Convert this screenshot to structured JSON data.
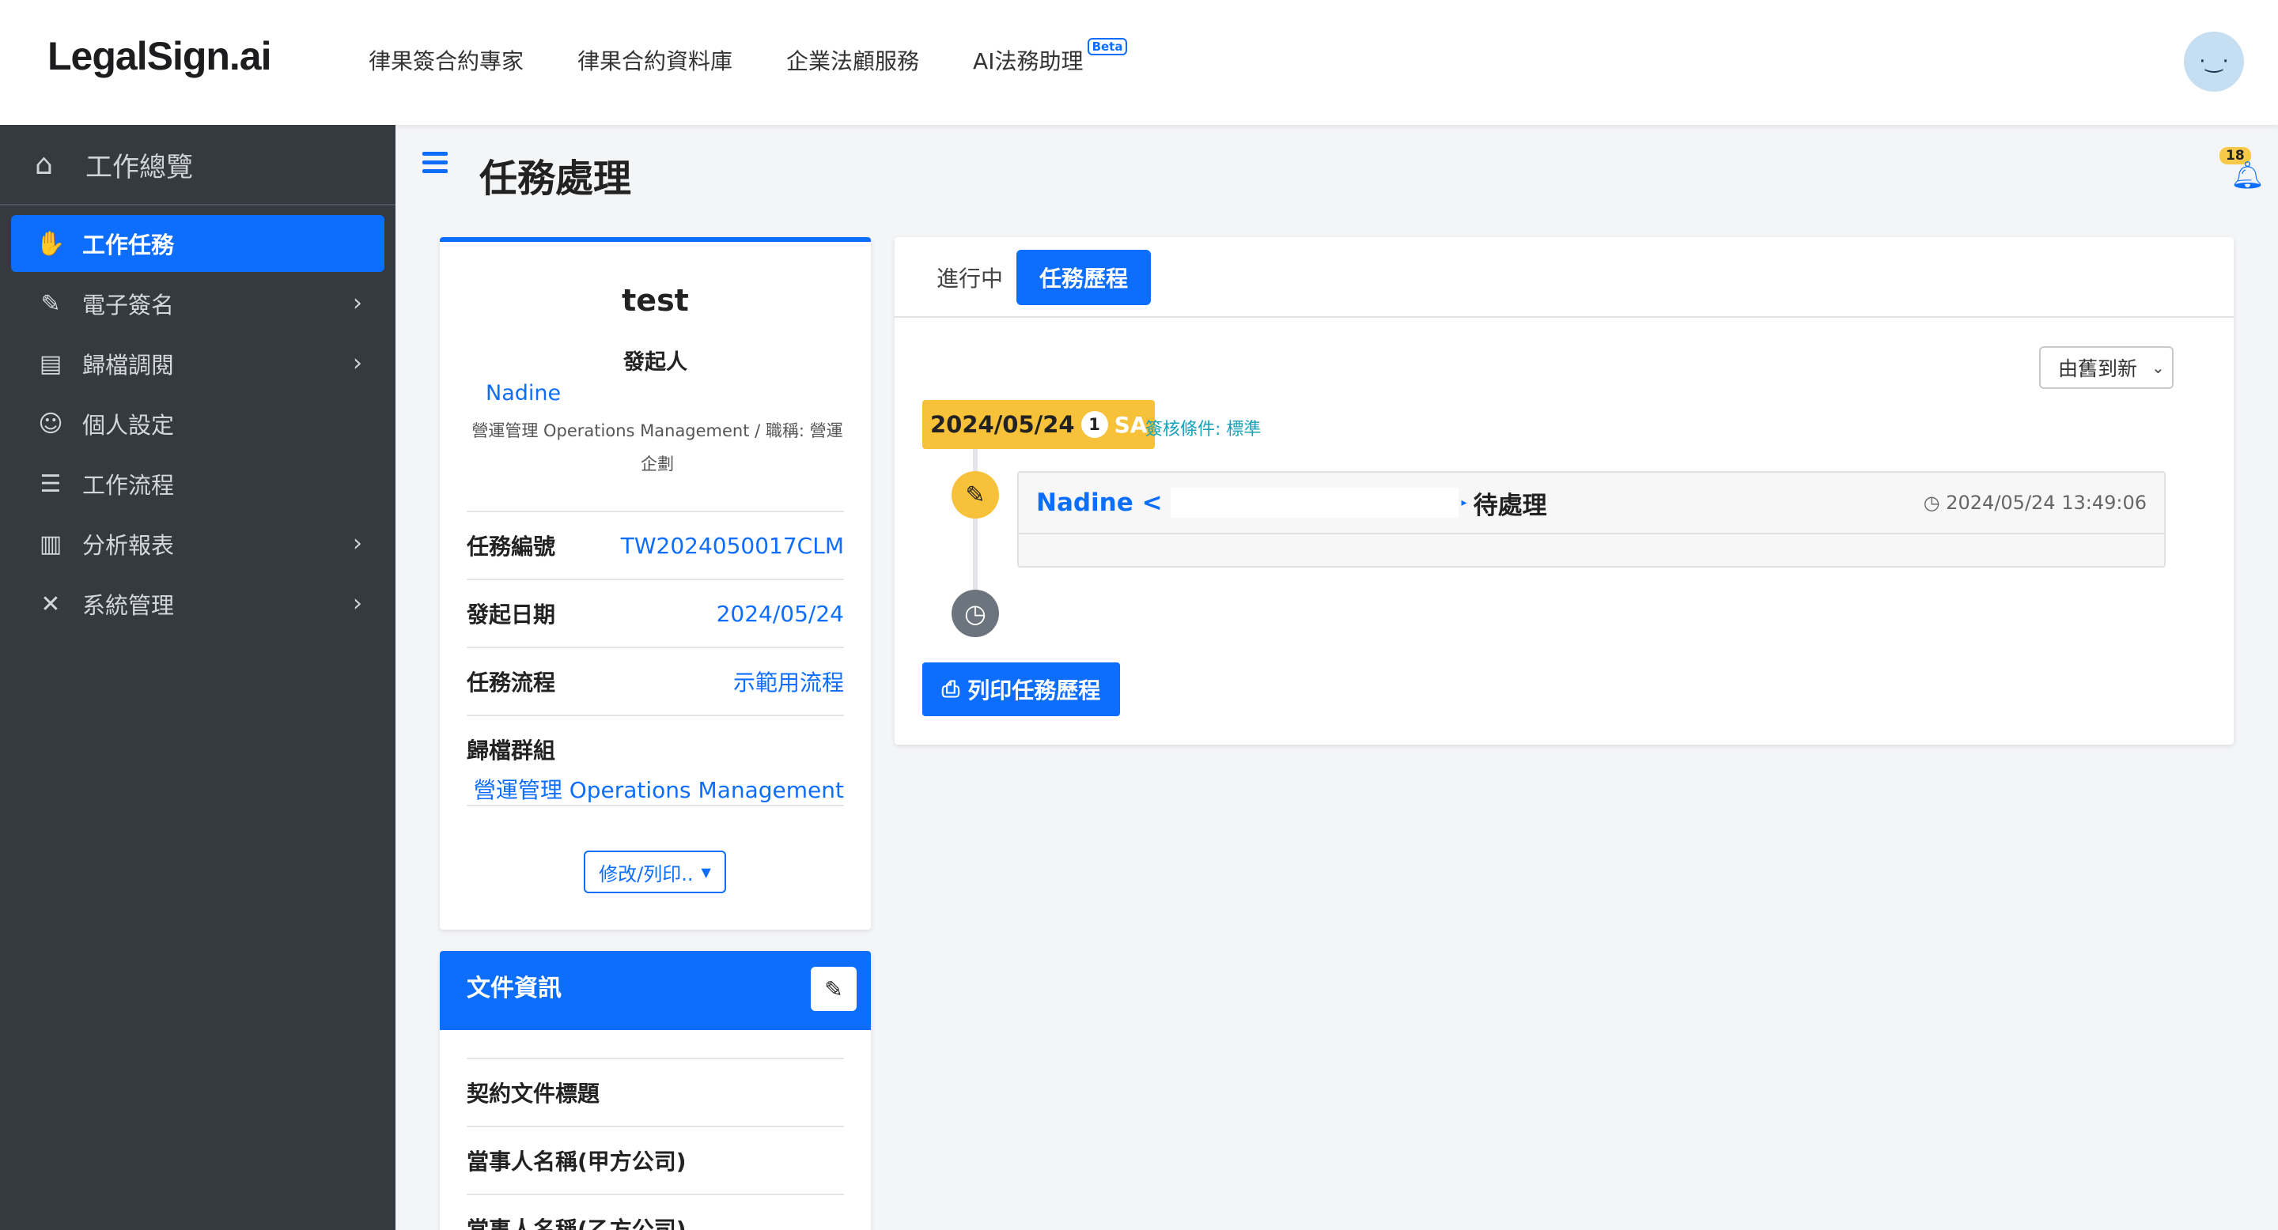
{
  "brand": {
    "logo_text": "LegalSign.ai"
  },
  "topnav": {
    "items": [
      {
        "label": "律果簽合約專家"
      },
      {
        "label": "律果合約資料庫"
      },
      {
        "label": "企業法顧服務"
      },
      {
        "label": "AI法務助理",
        "badge": "Beta"
      }
    ],
    "avatar_face": "·‿·"
  },
  "sidebar": {
    "header": "工作總覽",
    "items": [
      {
        "label": "工作任務",
        "icon": "handshake-icon",
        "active": true
      },
      {
        "label": "電子簽名",
        "icon": "signature-icon",
        "has_children": true
      },
      {
        "label": "歸檔調閱",
        "icon": "archive-icon",
        "has_children": true
      },
      {
        "label": "個人設定",
        "icon": "user-gear-icon"
      },
      {
        "label": "工作流程",
        "icon": "list-check-icon"
      },
      {
        "label": "分析報表",
        "icon": "chart-icon",
        "has_children": true
      },
      {
        "label": "系統管理",
        "icon": "tools-icon",
        "has_children": true
      }
    ]
  },
  "header": {
    "title": "任務處理",
    "notifications": "18"
  },
  "task_card": {
    "name": "test",
    "initiator_label": "發起人",
    "initiator_name": "Nadine",
    "initiator_dept": "營運管理 Operations Management / 職稱: 營運企劃",
    "rows": [
      {
        "key": "任務編號",
        "value": "TW2024050017CLM"
      },
      {
        "key": "發起日期",
        "value": "2024/05/24"
      },
      {
        "key": "任務流程",
        "value": "示範用流程"
      },
      {
        "key": "歸檔群組",
        "value": "營運管理 Operations Management"
      }
    ],
    "modify_button": "修改/列印.."
  },
  "doc_card": {
    "title": "文件資訊",
    "rows": [
      {
        "label": "契約文件標題"
      },
      {
        "label": "當事人名稱(甲方公司)"
      },
      {
        "label": "當事人名稱(乙方公司)"
      }
    ]
  },
  "history": {
    "tabs": [
      {
        "label": "進行中",
        "active": false
      },
      {
        "label": "任務歷程",
        "active": true
      }
    ],
    "sort": {
      "selected": "由舊到新"
    },
    "group": {
      "date": "2024/05/24",
      "count": "1",
      "tag": "SA",
      "condition": "簽核條件: 標準"
    },
    "event": {
      "name": "Nadine <",
      "status": "待處理",
      "time": "2024/05/24 13:49:06"
    },
    "print_button": "列印任務歷程"
  },
  "colors": {
    "primary": "#0d6efd",
    "sidebar_bg": "#343a40",
    "warning": "#f7c13a",
    "info": "#17a2b8"
  }
}
